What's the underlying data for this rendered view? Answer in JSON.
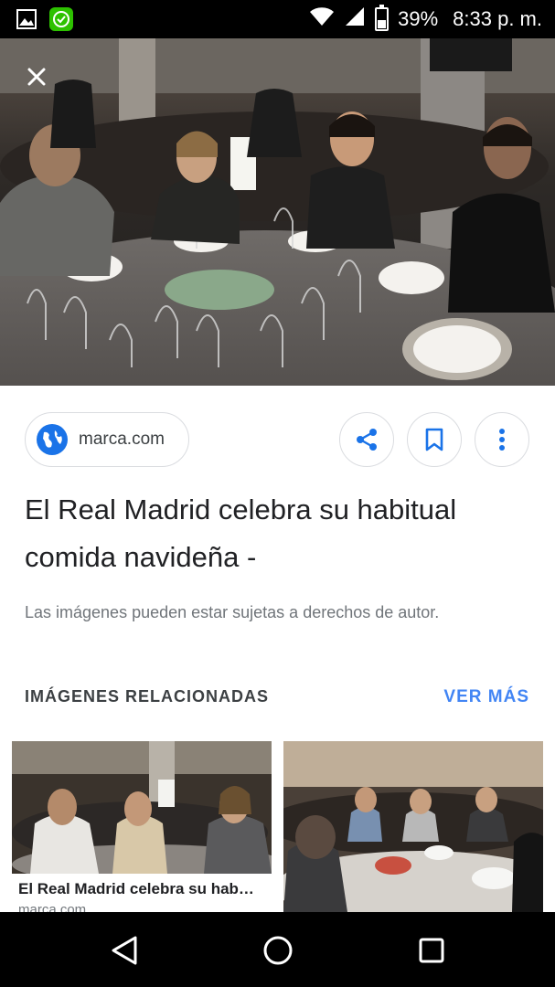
{
  "status_bar": {
    "battery": "39%",
    "time": "8:33 p. m.",
    "battery_level": 0.39,
    "icons": [
      "image-notification-icon",
      "wechat-app-icon",
      "wifi-icon",
      "cell-signal-icon",
      "battery-icon"
    ]
  },
  "viewer": {
    "close_icon": "close-icon",
    "source_domain": "marca.com",
    "title": "El Real Madrid celebra su habitual comida navideña -",
    "copyright_note": "Las imágenes pueden estar sujetas a derechos de autor.",
    "actions": [
      "share-icon",
      "bookmark-icon",
      "more-vert-icon"
    ]
  },
  "related": {
    "header": "IMÁGENES RELACIONADAS",
    "see_more": "VER MÁS",
    "items": [
      {
        "caption": "El Real Madrid celebra su hab…",
        "source": "marca.com"
      },
      {
        "caption": "",
        "source": ""
      }
    ]
  },
  "colors": {
    "accent": "#4285f4",
    "text_primary": "#202124",
    "text_secondary": "#70757a",
    "border": "#dadce0"
  },
  "nav_bar": {
    "icons": [
      "back-icon",
      "home-icon",
      "recents-icon"
    ]
  }
}
